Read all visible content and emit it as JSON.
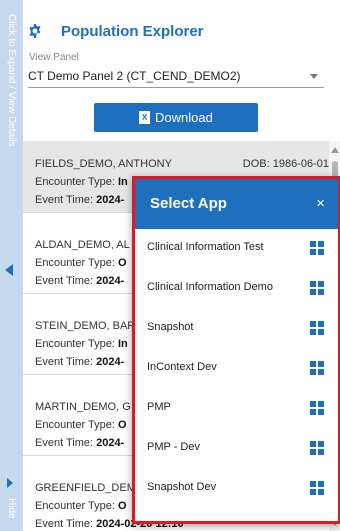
{
  "rail": {
    "expand_text": "Click to Expand / View Details",
    "hide_text": "Hide"
  },
  "header": {
    "title": "Population Explorer",
    "icon": "gear-icon"
  },
  "view_panel": {
    "label": "View Panel",
    "value": "CT Demo Panel 2 (CT_CEND_DEMO2)"
  },
  "download": {
    "label": "Download",
    "icon_glyph": "X"
  },
  "labels": {
    "encounter_type": "Encounter Type:",
    "event_time": "Event Time:"
  },
  "patients": [
    {
      "name": "FIELDS_DEMO, ANTHONY",
      "dob": "DOB: 1986-06-01",
      "encounter_type": "In",
      "event_time": "2024-"
    },
    {
      "name": "ALDAN_DEMO, AL",
      "dob": "",
      "encounter_type": "O",
      "event_time": "2024-"
    },
    {
      "name": "STEIN_DEMO, BAR",
      "dob": "",
      "encounter_type": "In",
      "event_time": "2024-"
    },
    {
      "name": "MARTIN_DEMO, G",
      "dob": "",
      "encounter_type": "O",
      "event_time": "2024-"
    },
    {
      "name": "GREENFIELD_DEM",
      "dob": "",
      "encounter_type": "O",
      "event_time": "2024-02-20 12:10"
    }
  ],
  "modal": {
    "title": "Select App",
    "close": "×",
    "apps": [
      {
        "label": "Clinical Information Test"
      },
      {
        "label": "Clinical Information Demo"
      },
      {
        "label": "Snapshot"
      },
      {
        "label": "InContext Dev"
      },
      {
        "label": "PMP"
      },
      {
        "label": "PMP - Dev"
      },
      {
        "label": "Snapshot Dev"
      }
    ]
  },
  "colors": {
    "accent": "#1f6fbf",
    "highlight_border": "#e4161e",
    "rail": "#c6d9ec",
    "selected_row": "#e6e6e6"
  }
}
